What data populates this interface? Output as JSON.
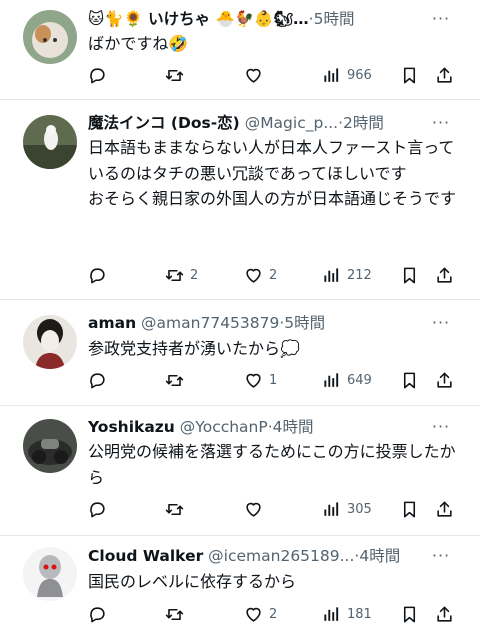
{
  "tweets": [
    {
      "name": "🐱🐈🌻 いけちゃ 🐣🐓👶🐿…",
      "handle": "",
      "time": "5時間",
      "text": "ばかですね🤣",
      "reply": "",
      "retweet": "",
      "like": "",
      "views": "966"
    },
    {
      "name": "魔法インコ (Dos-恋)",
      "handle": "@Magic_p...",
      "time": "2時間",
      "text": "日本語もままならない人が日本人ファースト言っているのはタチの悪い冗談であってほしいです\nおそらく親日家の外国人の方が日本語通じそうです",
      "reply": "",
      "retweet": "2",
      "like": "2",
      "views": "212"
    },
    {
      "name": "aman",
      "handle": "@aman77453879",
      "time": "5時間",
      "text": "参政党支持者が湧いたから💭",
      "reply": "",
      "retweet": "",
      "like": "1",
      "views": "649"
    },
    {
      "name": "Yoshikazu",
      "handle": "@YocchanP",
      "time": "4時間",
      "text": "公明党の候補を落選するためにこの方に投票したから",
      "reply": "",
      "retweet": "",
      "like": "",
      "views": "305"
    },
    {
      "name": "Cloud Walker",
      "handle": "@iceman265189...",
      "time": "4時間",
      "text": "国民のレベルに依存するから",
      "reply": "",
      "retweet": "",
      "like": "2",
      "views": "181"
    }
  ],
  "ui": {
    "dot": "·",
    "more_label": "···"
  },
  "icons": {
    "reply": "reply-icon",
    "retweet": "retweet-icon",
    "like": "heart-icon",
    "views": "views-icon",
    "bookmark": "bookmark-icon",
    "share": "share-icon"
  }
}
